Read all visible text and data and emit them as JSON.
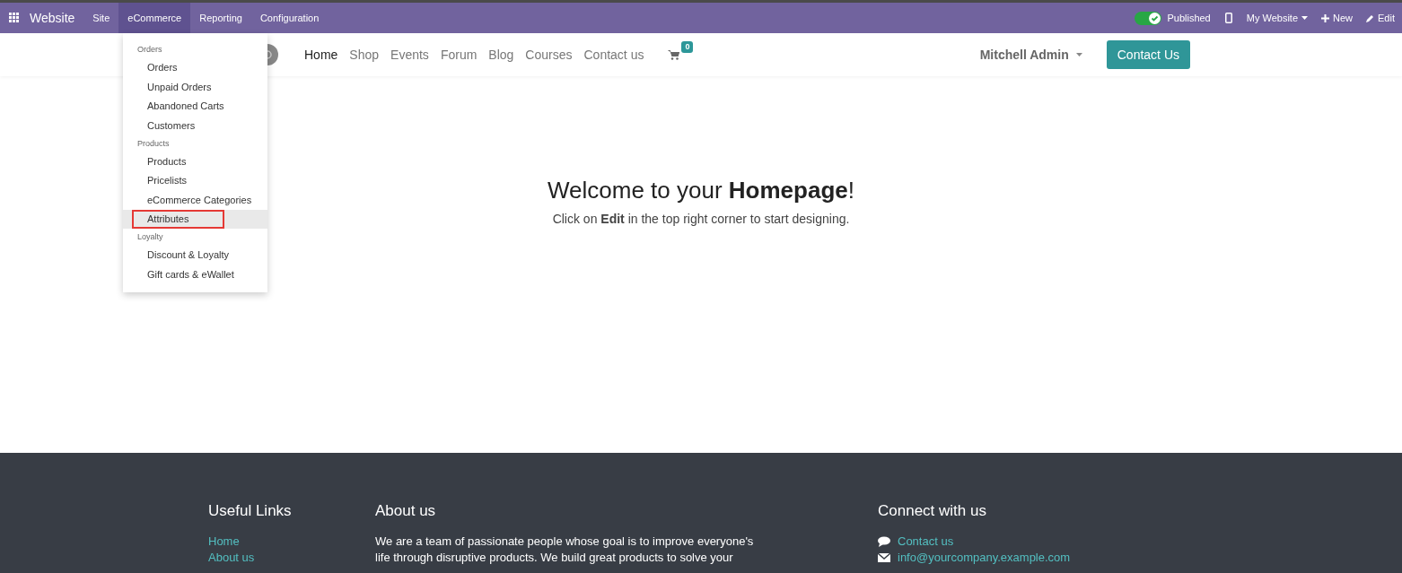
{
  "topbar": {
    "app_name": "Website",
    "menus": [
      {
        "label": "Site",
        "selected": false
      },
      {
        "label": "eCommerce",
        "selected": true
      },
      {
        "label": "Reporting",
        "selected": false
      },
      {
        "label": "Configuration",
        "selected": false
      }
    ],
    "published": {
      "label": "Published",
      "on": true
    },
    "website": "My Website",
    "new": "New",
    "edit": "Edit"
  },
  "dropdown": {
    "sections": [
      {
        "heading": "Orders",
        "items": [
          {
            "label": "Orders",
            "selected": false
          },
          {
            "label": "Unpaid Orders",
            "selected": false
          },
          {
            "label": "Abandoned Carts",
            "selected": false
          },
          {
            "label": "Customers",
            "selected": false
          }
        ]
      },
      {
        "heading": "Products",
        "items": [
          {
            "label": "Products",
            "selected": false
          },
          {
            "label": "Pricelists",
            "selected": false
          },
          {
            "label": "eCommerce Categories",
            "selected": false
          },
          {
            "label": "Attributes",
            "selected": true
          }
        ]
      },
      {
        "heading": "Loyalty",
        "items": [
          {
            "label": "Discount & Loyalty",
            "selected": false
          },
          {
            "label": "Gift cards & eWallet",
            "selected": false
          }
        ]
      }
    ]
  },
  "site_nav": {
    "links": [
      {
        "label": "Home",
        "selected": true
      },
      {
        "label": "Shop",
        "selected": false
      },
      {
        "label": "Events",
        "selected": false
      },
      {
        "label": "Forum",
        "selected": false
      },
      {
        "label": "Blog",
        "selected": false
      },
      {
        "label": "Courses",
        "selected": false
      },
      {
        "label": "Contact us",
        "selected": false
      }
    ],
    "cart_count": "0",
    "user": "Mitchell Admin",
    "cta": "Contact Us"
  },
  "hero": {
    "title": "Welcome to your **Homepage**!",
    "subtitle": "Click on **Edit** in the top right corner to start designing."
  },
  "footer": {
    "useful_links": {
      "title": "Useful Links",
      "links": [
        "Home",
        "About us"
      ]
    },
    "about": {
      "title": "About us",
      "text": "We are a team of passionate people whose goal is to improve everyone's life through disruptive products. We build great products to solve your"
    },
    "connect": {
      "title": "Connect with us",
      "items": [
        {
          "kind": "chat",
          "label": "Contact us"
        },
        {
          "kind": "mail",
          "label": "info@yourcompany.example.com"
        }
      ]
    }
  }
}
